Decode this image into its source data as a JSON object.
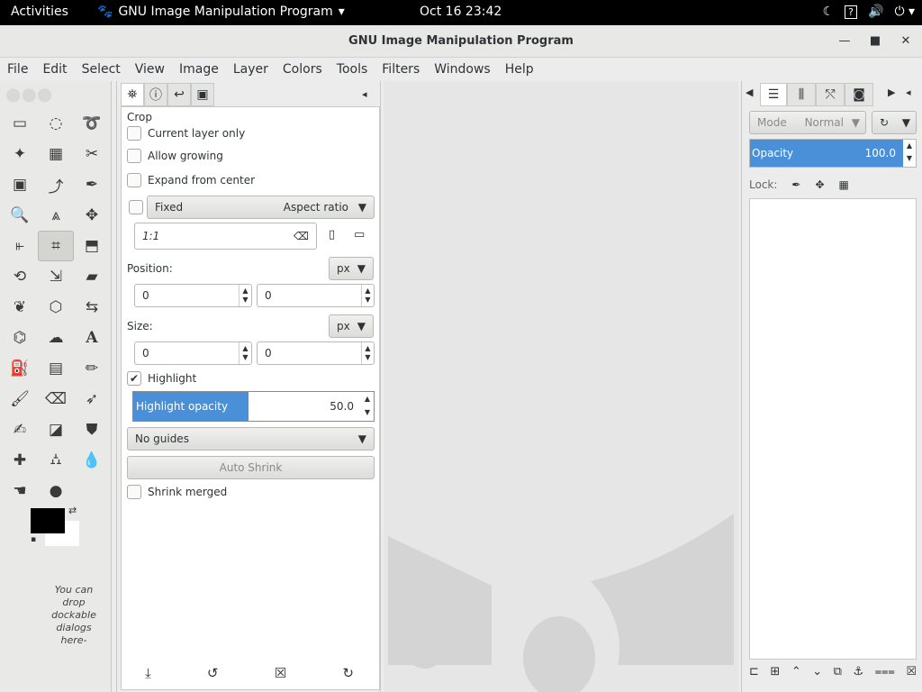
{
  "topbar": {
    "activities": "Activities",
    "app_name": "GNU Image Manipulation Program",
    "clock": "Oct 16  23:42"
  },
  "window": {
    "title": "GNU Image Manipulation Program"
  },
  "menu": [
    "File",
    "Edit",
    "Select",
    "View",
    "Image",
    "Layer",
    "Colors",
    "Tools",
    "Filters",
    "Windows",
    "Help"
  ],
  "toolbox": {
    "drop_hint": "You can drop dockable dialogs here-"
  },
  "tool_options": {
    "title": "Crop",
    "current_layer_only": "Current layer only",
    "allow_growing": "Allow growing",
    "expand_from_center": "Expand from center",
    "fixed_label": "Fixed",
    "fixed_mode": "Aspect ratio",
    "ratio_value": "1:1",
    "position_label": "Position:",
    "position_unit": "px",
    "position_x": "0",
    "position_y": "0",
    "size_label": "Size:",
    "size_unit": "px",
    "size_w": "0",
    "size_h": "0",
    "highlight_label": "Highlight",
    "highlight_opacity_label": "Highlight opacity",
    "highlight_opacity_value": "50.0",
    "guides": "No guides",
    "auto_shrink": "Auto Shrink",
    "shrink_merged": "Shrink merged"
  },
  "layers": {
    "mode_label": "Mode",
    "mode_value": "Normal",
    "opacity_label": "Opacity",
    "opacity_value": "100.0",
    "lock_label": "Lock:"
  },
  "colors": {
    "accent": "#4a90d9",
    "fg": "#000000",
    "bg": "#ffffff"
  }
}
